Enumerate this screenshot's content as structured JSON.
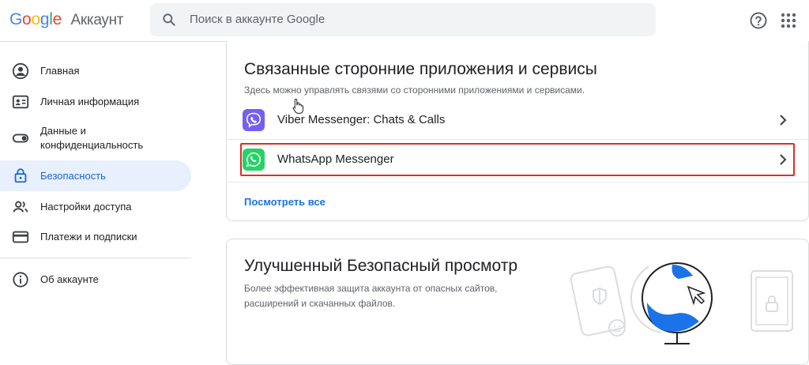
{
  "header": {
    "logo_letters": [
      "G",
      "o",
      "o",
      "g",
      "l",
      "e"
    ],
    "product": "Аккаунт",
    "search_placeholder": "Поиск в аккаунте Google"
  },
  "sidebar": {
    "items": [
      {
        "label": "Главная",
        "icon": "home-icon"
      },
      {
        "label": "Личная информация",
        "icon": "person-card-icon"
      },
      {
        "label": "Данные и конфиденциальность",
        "icon": "toggle-icon"
      },
      {
        "label": "Безопасность",
        "icon": "lock-icon",
        "active": true
      },
      {
        "label": "Настройки доступа",
        "icon": "people-icon"
      },
      {
        "label": "Платежи и подписки",
        "icon": "credit-card-icon"
      },
      {
        "label": "Об аккаунте",
        "icon": "info-icon"
      }
    ]
  },
  "third_party": {
    "title": "Связанные сторонние приложения и сервисы",
    "description": "Здесь можно управлять связями со сторонними приложениями и сервисами.",
    "apps": [
      {
        "name": "Viber Messenger: Chats & Calls",
        "icon": "viber-icon",
        "color": "#7360f2"
      },
      {
        "name": "WhatsApp Messenger",
        "icon": "whatsapp-icon",
        "color": "#25d366"
      }
    ],
    "see_all": "Посмотреть все"
  },
  "safe_browsing": {
    "title": "Улучшенный Безопасный просмотр",
    "description": "Более эффективная защита аккаунта от опасных сайтов, расширений и скачанных файлов."
  },
  "colors": {
    "accent": "#1a73e8",
    "active_bg": "#e8f0fe",
    "highlight": "#d93025"
  }
}
